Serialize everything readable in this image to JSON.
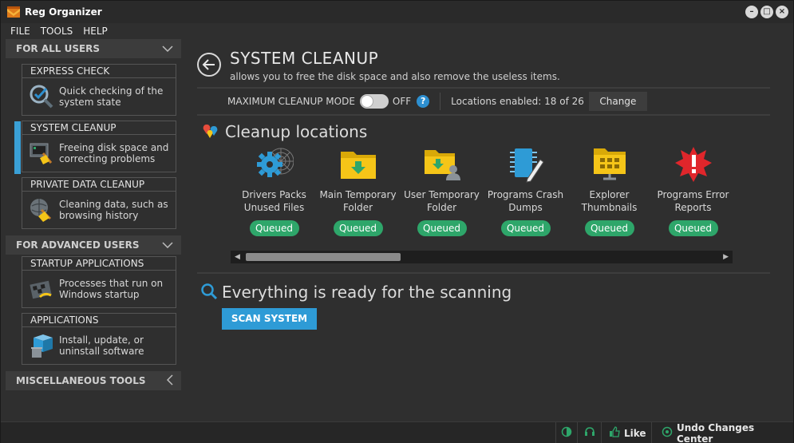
{
  "app": {
    "title": "Reg Organizer"
  },
  "menu": [
    "FILE",
    "TOOLS",
    "HELP"
  ],
  "sidebar": {
    "sections": [
      {
        "label": "FOR ALL USERS",
        "chevron": "chevron-down-icon"
      },
      {
        "label": "FOR ADVANCED USERS",
        "chevron": "chevron-down-icon"
      },
      {
        "label": "MISCELLANEOUS TOOLS",
        "chevron": "chevron-left-icon"
      }
    ],
    "items": [
      {
        "title": "EXPRESS CHECK",
        "line1": "Quick checking of the",
        "line2": "system state",
        "icon": "magnifier-check-icon"
      },
      {
        "title": "SYSTEM CLEANUP",
        "line1": "Freeing disk space and",
        "line2": "correcting problems",
        "icon": "broom-computer-icon",
        "active": true
      },
      {
        "title": "PRIVATE DATA CLEANUP",
        "line1": "Cleaning data, such as",
        "line2": "browsing history",
        "icon": "globe-broom-icon"
      },
      {
        "title": "STARTUP APPLICATIONS",
        "line1": "Processes that run on",
        "line2": "Windows startup",
        "icon": "startup-flag-icon"
      },
      {
        "title": "APPLICATIONS",
        "line1": "Install, update, or",
        "line2": "uninstall software",
        "icon": "box-trash-icon"
      }
    ]
  },
  "main": {
    "title": "SYSTEM CLEANUP",
    "subtitle": "allows you to free the disk space and also remove the useless items.",
    "mode_label": "MAXIMUM CLEANUP MODE",
    "mode_state": "OFF",
    "mode_on": false,
    "help": "?",
    "locations_enabled": "Locations enabled: 18 of 26",
    "change_label": "Change",
    "locations_title": "Cleanup locations",
    "locations": [
      {
        "line1": "Drivers Packs",
        "line2": "Unused Files",
        "status": "Queued",
        "icon": "gear-web-icon"
      },
      {
        "line1": "Main Temporary",
        "line2": "Folder",
        "status": "Queued",
        "icon": "folder-download-icon"
      },
      {
        "line1": "User Temporary",
        "line2": "Folder",
        "status": "Queued",
        "icon": "folder-user-icon"
      },
      {
        "line1": "Programs Crash",
        "line2": "Dumps",
        "status": "Queued",
        "icon": "chip-pen-icon"
      },
      {
        "line1": "Explorer",
        "line2": "Thumbnails",
        "status": "Queued",
        "icon": "folder-grid-icon"
      },
      {
        "line1": "Programs Error",
        "line2": "Reports",
        "status": "Queued",
        "icon": "error-burst-icon"
      }
    ],
    "ready_title": "Everything is ready for the scanning",
    "scan_label": "SCAN SYSTEM"
  },
  "statusbar": {
    "like_label": "Like",
    "undo_label": "Undo Changes Center"
  },
  "colors": {
    "accent": "#2e9bd6",
    "queued": "#2ea66a",
    "folder": "#f5c518"
  }
}
